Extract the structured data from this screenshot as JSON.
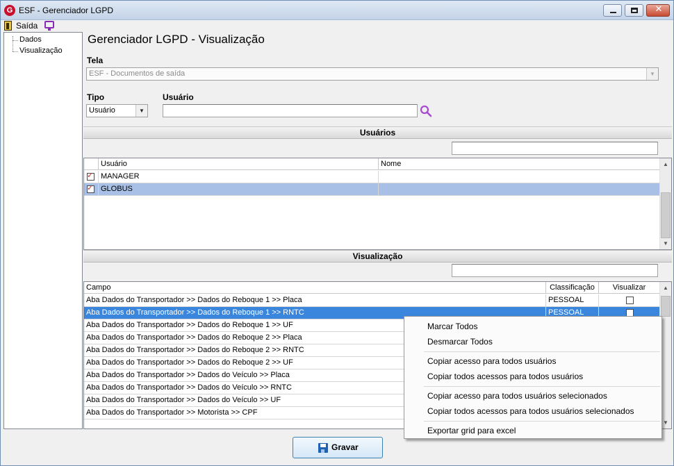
{
  "window": {
    "logo_letter": "G",
    "title": "ESF - Gerenciador LGPD"
  },
  "menubar": {
    "exit_label": "Saída"
  },
  "tree": {
    "items": [
      "Dados",
      "Visualização"
    ]
  },
  "page": {
    "title": "Gerenciador LGPD - Visualização"
  },
  "form": {
    "tela_label": "Tela",
    "tela_value": "ESF - Documentos de saída",
    "tipo_label": "Tipo",
    "tipo_value": "Usuário",
    "usuario_label": "Usuário",
    "usuario_value": ""
  },
  "users_section": {
    "title": "Usuários",
    "search_value": "",
    "columns": [
      "Usuário",
      "Nome"
    ],
    "rows": [
      {
        "checked": true,
        "usuario": "MANAGER",
        "nome": ""
      },
      {
        "checked": true,
        "usuario": "GLOBUS",
        "nome": ""
      }
    ]
  },
  "view_section": {
    "title": "Visualização",
    "search_value": "",
    "columns": [
      "Campo",
      "Classificação",
      "Visualizar"
    ],
    "rows": [
      {
        "campo": "Aba Dados do Transportador >> Dados do Reboque 1 >> Placa",
        "classificacao": "PESSOAL",
        "visualizar": false
      },
      {
        "campo": "Aba Dados do Transportador >> Dados do Reboque 1 >> RNTC",
        "classificacao": "PESSOAL",
        "visualizar": false
      },
      {
        "campo": "Aba Dados do Transportador >> Dados do Reboque 1 >> UF",
        "classificacao": "",
        "visualizar": false
      },
      {
        "campo": "Aba Dados do Transportador >> Dados do Reboque 2 >> Placa",
        "classificacao": "",
        "visualizar": false
      },
      {
        "campo": "Aba Dados do Transportador >> Dados do Reboque 2 >> RNTC",
        "classificacao": "",
        "visualizar": false
      },
      {
        "campo": "Aba Dados do Transportador >> Dados do Reboque 2 >> UF",
        "classificacao": "",
        "visualizar": false
      },
      {
        "campo": "Aba Dados do Transportador >> Dados do Veículo >> Placa",
        "classificacao": "",
        "visualizar": false
      },
      {
        "campo": "Aba Dados do Transportador >> Dados do Veículo >> RNTC",
        "classificacao": "",
        "visualizar": false
      },
      {
        "campo": "Aba Dados do Transportador >> Dados do Veículo >> UF",
        "classificacao": "",
        "visualizar": false
      },
      {
        "campo": "Aba Dados do Transportador >> Motorista >> CPF",
        "classificacao": "",
        "visualizar": false
      }
    ]
  },
  "context_menu": {
    "items": [
      "Marcar Todos",
      "Desmarcar Todos",
      "Copiar acesso para todos usuários",
      "Copiar todos acessos para todos usuários",
      "Copiar acesso para todos usuários selecionados",
      "Copiar todos acessos para todos usuários selecionados",
      "Exportar grid para excel"
    ]
  },
  "footer": {
    "save_label": "Gravar"
  },
  "colors": {
    "selected_row": "#3a86dc",
    "selected_light_row": "#a9c0e6",
    "search_icon": "#a64bd1",
    "check_mark": "#d4261a"
  }
}
